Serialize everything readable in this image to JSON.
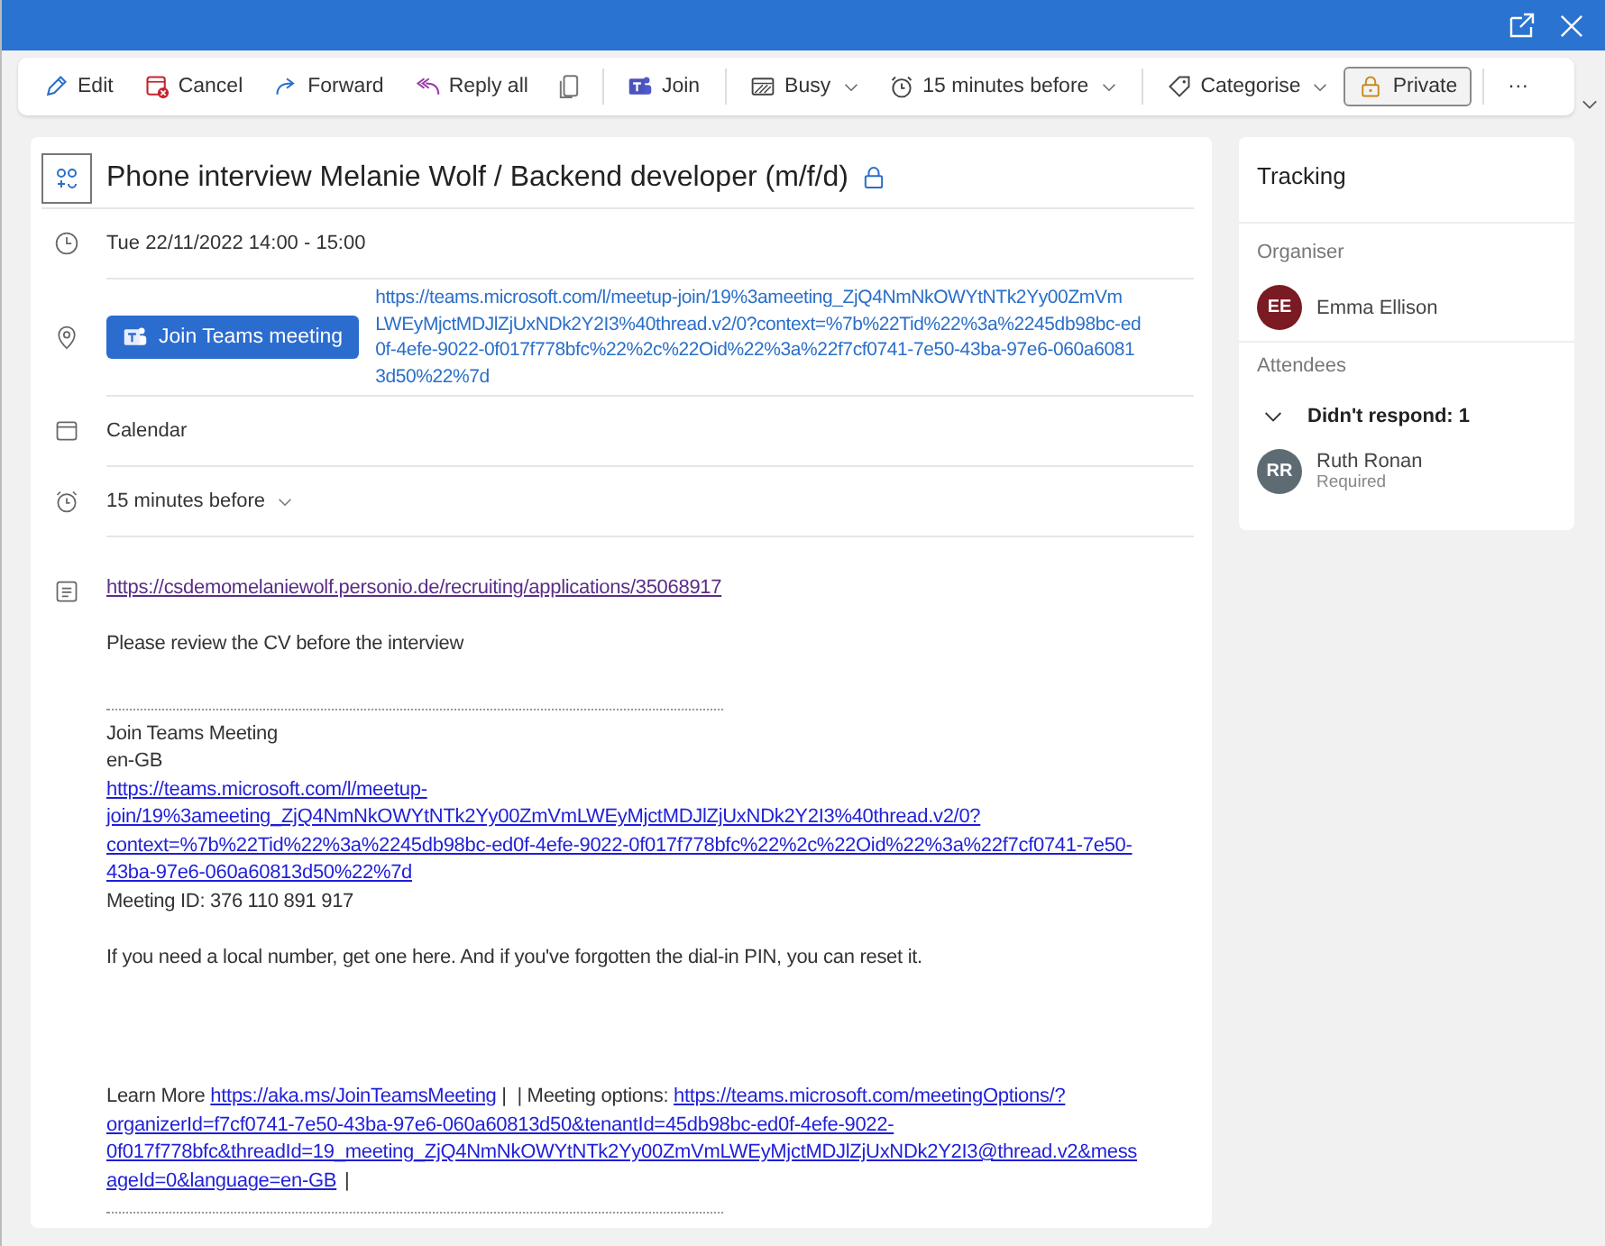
{
  "toolbar": [
    {
      "kind": "button",
      "label": "Edit",
      "selected": false
    },
    {
      "kind": "button",
      "label": "Cancel",
      "selected": false
    },
    {
      "kind": "button",
      "label": "Forward",
      "selected": false
    },
    {
      "kind": "button",
      "label": "Reply all",
      "selected": false
    },
    {
      "kind": "icon",
      "selected": false
    },
    {
      "kind": "sep"
    },
    {
      "kind": "button",
      "label": "Join",
      "selected": false
    },
    {
      "kind": "sep"
    },
    {
      "kind": "dropdown",
      "label": "Busy",
      "selected": false
    },
    {
      "kind": "dropdown",
      "label": "15 minutes before",
      "selected": false
    },
    {
      "kind": "sep"
    },
    {
      "kind": "dropdown",
      "label": "Categorise",
      "selected": false
    },
    {
      "kind": "button",
      "label": "Private",
      "selected": true
    },
    {
      "kind": "sep"
    },
    {
      "kind": "more",
      "label": "···",
      "selected": false
    }
  ],
  "event": {
    "title": "Phone interview Melanie Wolf / Backend developer (m/f/d)",
    "private": true,
    "time": "Tue 22/11/2022 14:00 - 15:00",
    "join_button": "Join Teams meeting",
    "location_lines": [
      "https://teams.microsoft.com/l/meetup-join/19%3ameeting_ZjQ4NmNkOWYtNTk2Yy00ZmVm",
      "LWEyMjctMDJlZjUxNDk2Y2I3%40thread.v2/0?context=%7b%22Tid%22%3a%2245db98bc-ed",
      "0f-4efe-9022-0f017f778bfc%22%2c%22Oid%22%3a%22f7cf0741-7e50-43ba-97e6-060a6081",
      "3d50%22%7d"
    ],
    "calendar": "Calendar",
    "reminder": "15 minutes before"
  },
  "body": {
    "top_link": "https://csdemomelaniewolf.personio.de/recruiting/applications/35068917",
    "note": "Please review the CV before the interview",
    "teams_heading": "Join Teams Meeting",
    "locale": "en-GB",
    "meeting_link_lines": [
      "https://teams.microsoft.com/l/meetup-",
      "join/19%3ameeting_ZjQ4NmNkOWYtNTk2Yy00ZmVmLWEyMjctMDJlZjUxNDk2Y2I3%40thread.v2/0?",
      "context=%7b%22Tid%22%3a%2245db98bc-ed0f-4efe-9022-0f017f778bfc%22%2c%22Oid%22%3a%22f7cf0741-7e50-",
      "43ba-97e6-060a60813d50%22%7d"
    ],
    "meeting_id": "Meeting ID: 376 110 891 917",
    "help": "If you need a local number, get one here. And if you've forgotten the dial-in PIN, you can reset it.",
    "footer": {
      "prefix": "Learn More",
      "learn_link": "https://aka.ms/JoinTeamsMeeting",
      "middle": "|  | Meeting options:",
      "options_lines": [
        "https://teams.microsoft.com/meetingOptions/?",
        "organizerId=f7cf0741-7e50-43ba-97e6-060a60813d50&tenantId=45db98bc-ed0f-4efe-9022-",
        "0f017f778bfc&threadId=19_meeting_ZjQ4NmNkOWYtNTk2Yy00ZmVmLWEyMjctMDJlZjUxNDk2Y2I3@thread.v2&mess",
        "ageId=0&language=en-GB"
      ],
      "suffix": "|"
    }
  },
  "tracking": {
    "title": "Tracking",
    "organiser_label": "Organiser",
    "organiser": {
      "initials": "EE",
      "name": "Emma Ellison",
      "color": "#7a1a22"
    },
    "attendees_label": "Attendees",
    "group": "Didn't respond: 1",
    "expanded": true,
    "attendees": [
      {
        "initials": "RR",
        "name": "Ruth Ronan",
        "role": "Required",
        "color": "#5f6b73"
      }
    ]
  }
}
